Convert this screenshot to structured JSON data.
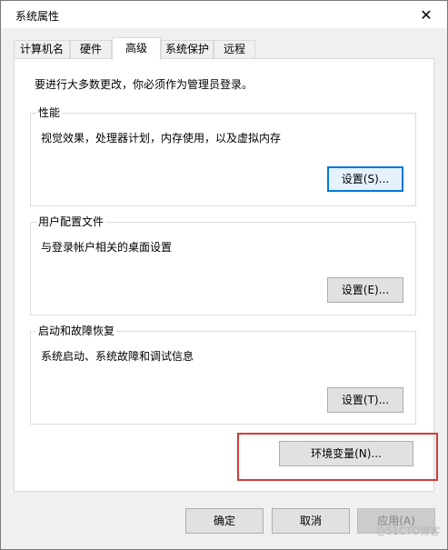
{
  "window": {
    "title": "系统属性",
    "close_label": "✕"
  },
  "tabs": [
    {
      "label": "计算机名",
      "active": false
    },
    {
      "label": "硬件",
      "active": false
    },
    {
      "label": "高级",
      "active": true
    },
    {
      "label": "系统保护",
      "active": false
    },
    {
      "label": "远程",
      "active": false
    }
  ],
  "intro": "要进行大多数更改，你必须作为管理员登录。",
  "groups": [
    {
      "label": "性能",
      "desc": "视觉效果，处理器计划，内存使用，以及虚拟内存",
      "button": "设置(S)..."
    },
    {
      "label": "用户配置文件",
      "desc": "与登录帐户相关的桌面设置",
      "button": "设置(E)..."
    },
    {
      "label": "启动和故障恢复",
      "desc": "系统启动、系统故障和调试信息",
      "button": "设置(T)..."
    }
  ],
  "env_button": "环境变量(N)...",
  "footer": {
    "ok": "确定",
    "cancel": "取消",
    "apply": "应用(A)"
  },
  "watermark": "@51CTO博客",
  "colors": {
    "accent": "#0078d7",
    "highlight": "#d13b3b"
  }
}
